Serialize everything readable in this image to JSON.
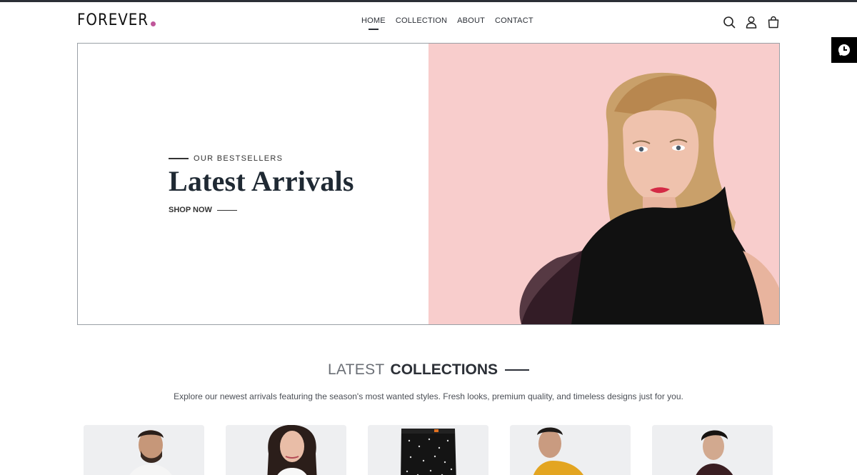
{
  "brand": {
    "logo_text": "FOREVER",
    "accent": "#c0579a"
  },
  "nav": {
    "items": [
      {
        "label": "HOME",
        "active": true
      },
      {
        "label": "COLLECTION",
        "active": false
      },
      {
        "label": "ABOUT",
        "active": false
      },
      {
        "label": "CONTACT",
        "active": false
      }
    ]
  },
  "header_icons": [
    "search-icon",
    "user-icon",
    "shopping-bag-icon"
  ],
  "float_button": {
    "icon": "chat-icon"
  },
  "hero": {
    "kicker": "OUR BESTSELLERS",
    "headline": "Latest Arrivals",
    "cta": "SHOP NOW",
    "image_bg": "#f8cdcc"
  },
  "collections": {
    "title_light": "LATEST",
    "title_bold": "COLLECTIONS",
    "description": "Explore our newest arrivals featuring the season's most wanted styles. Fresh looks, premium quality, and timeless designs just for you."
  },
  "products": [
    {
      "image": "man-white-shirt"
    },
    {
      "image": "woman-white-top"
    },
    {
      "image": "black-patterned-pants"
    },
    {
      "image": "man-mustard-shirt"
    },
    {
      "image": "man-dark-shirt"
    }
  ]
}
